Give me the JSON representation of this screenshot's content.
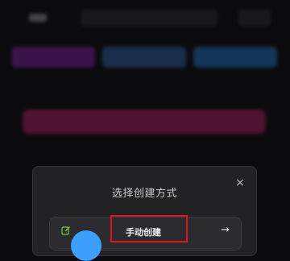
{
  "background": {
    "logo_text": "",
    "top_select_left": "",
    "top_select_right": "",
    "top_right_label": "",
    "tabs": [
      "",
      "",
      ""
    ],
    "banner_label": ""
  },
  "modal": {
    "title": "选择创建方式",
    "close_symbol": "×",
    "option": {
      "label": "手动创建",
      "icon": "edit-icon",
      "arrow": "→"
    }
  },
  "colors": {
    "modal_bg": "#222225",
    "highlight": "#e0161c",
    "edit_icon": "#7ec83f",
    "tab_purple": "#7b1fa2",
    "tab_blue": "#2e5f9e",
    "tab_green": "#1d6fbf",
    "banner": "#ad1e66"
  }
}
